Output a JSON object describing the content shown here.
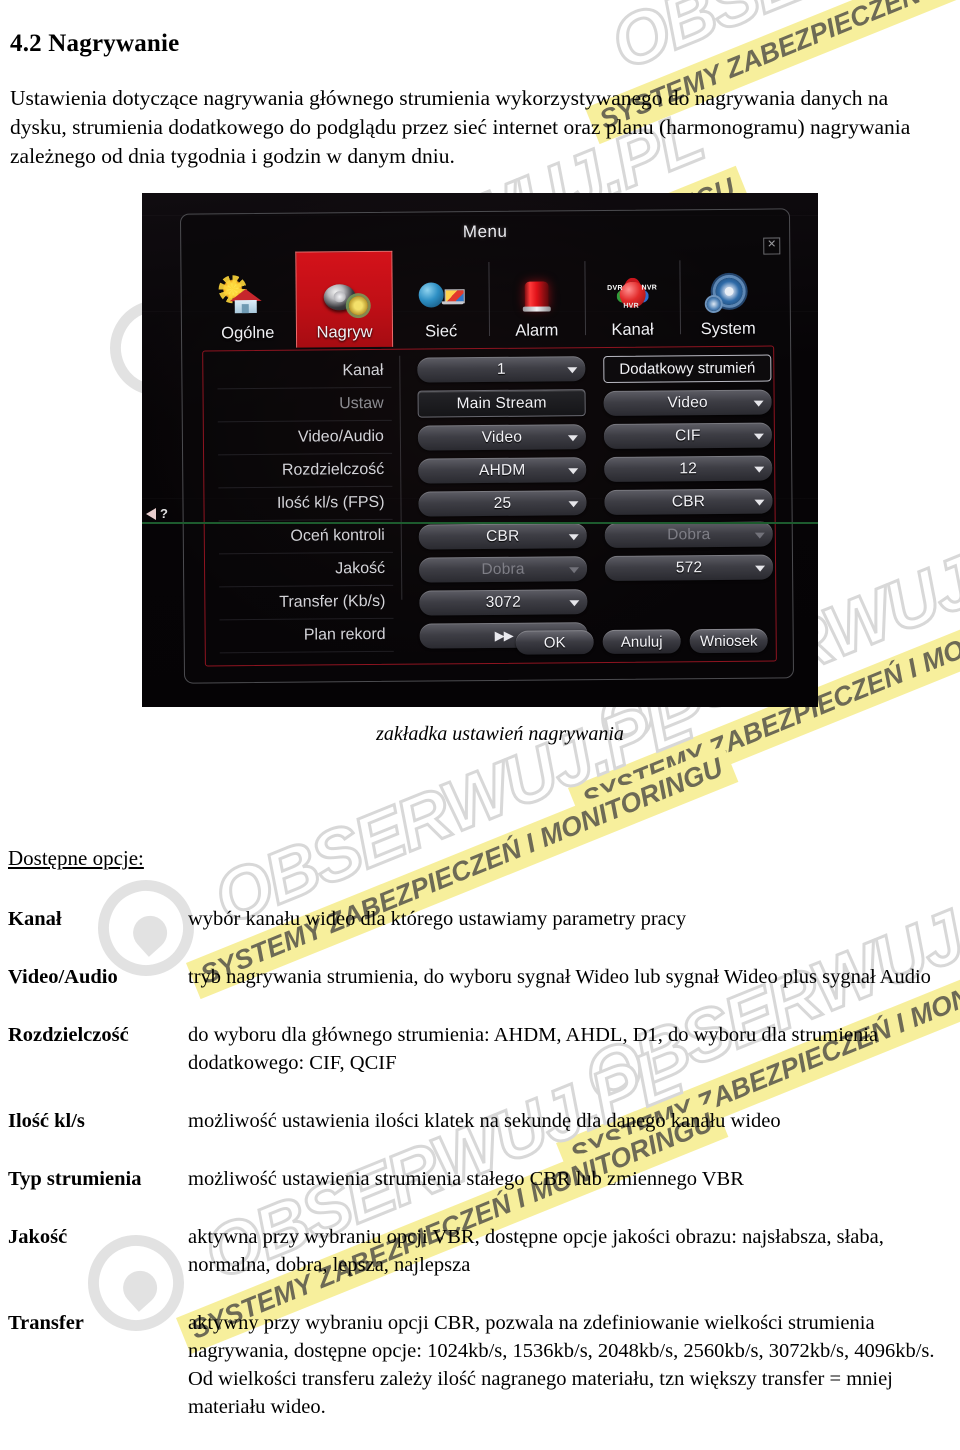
{
  "document": {
    "heading": "4.2 Nagrywanie",
    "intro": "Ustawienia dotyczące nagrywania głównego strumienia wykorzystywanego do nagrywania danych na dysku, strumienia dodatkowego do podglądu przez sieć internet oraz planu (harmonogramu) nagrywania zależnego od dnia tygodnia i godzin w danym dniu.",
    "figure_caption": "zakładka ustawień nagrywania"
  },
  "watermark": {
    "brand": "OBSERWUJ.PL",
    "tagline": "SYSTEMY ZABEZPIECZEŃ I MONITORINGU",
    "brand_color": "#d8d8d8",
    "bar_color": "#f7ef9c"
  },
  "dvr": {
    "window_title": "Menu",
    "close_icon": "✕",
    "tabs": [
      {
        "label": "Ogólne",
        "icon": "house-sun-icon",
        "active": false
      },
      {
        "label": "Nagryw",
        "icon": "film-reel-gear-icon",
        "active": true
      },
      {
        "label": "Sieć",
        "icon": "globe-laptop-icon",
        "active": false
      },
      {
        "label": "Alarm",
        "icon": "alarm-beacon-icon",
        "active": false
      },
      {
        "label": "Kanał",
        "icon": "dvr-nvr-hvr-icon",
        "active": false
      },
      {
        "label": "System",
        "icon": "blue-gear-icon",
        "active": false
      }
    ],
    "kanal_icon_labels": {
      "dvr": "DVR",
      "nvr": "NVR",
      "hvr": "HVR"
    },
    "field_labels": [
      {
        "text": "Kanał",
        "dim": false
      },
      {
        "text": "Ustaw",
        "dim": true
      },
      {
        "text": "Video/Audio",
        "dim": false
      },
      {
        "text": "Rozdzielczość",
        "dim": false
      },
      {
        "text": "Ilość kl/s (FPS)",
        "dim": false
      },
      {
        "text": "Oceń kontroli",
        "dim": false
      },
      {
        "text": "Jakość",
        "dim": false
      },
      {
        "text": "Transfer (Kb/s)",
        "dim": false
      },
      {
        "text": "Plan rekord",
        "dim": false
      }
    ],
    "main_column": [
      {
        "value": "1",
        "type": "dropdown",
        "dim": false
      },
      {
        "value": "Main Stream",
        "type": "flat",
        "dim": false
      },
      {
        "value": "Video",
        "type": "dropdown",
        "dim": false
      },
      {
        "value": "AHDM",
        "type": "dropdown",
        "dim": false
      },
      {
        "value": "25",
        "type": "dropdown",
        "dim": false
      },
      {
        "value": "CBR",
        "type": "dropdown",
        "dim": false
      },
      {
        "value": "Dobra",
        "type": "dropdown",
        "dim": true
      },
      {
        "value": "3072",
        "type": "dropdown",
        "dim": false
      },
      {
        "value": "▶▶",
        "type": "forward",
        "dim": false
      }
    ],
    "sub_column": {
      "header": "Dodatkowy strumień",
      "fields": [
        {
          "value": "Video",
          "dim": false
        },
        {
          "value": "CIF",
          "dim": false
        },
        {
          "value": "12",
          "dim": false
        },
        {
          "value": "CBR",
          "dim": false
        },
        {
          "value": "Dobra",
          "dim": true
        },
        {
          "value": "572",
          "dim": false
        }
      ]
    },
    "buttons": [
      {
        "label": "OK"
      },
      {
        "label": "Anuluj"
      },
      {
        "label": "Wniosek"
      }
    ]
  },
  "options": {
    "heading": "Dostępne opcje:",
    "rows": [
      {
        "term": "Kanał",
        "description": "wybór kanału wideo dla którego ustawiamy parametry pracy"
      },
      {
        "term": "Video/Audio",
        "description": "tryb nagrywania strumienia, do wyboru sygnał Wideo lub sygnał Wideo plus sygnał Audio"
      },
      {
        "term": "Rozdzielczość",
        "description": "do wyboru dla głównego strumienia: AHDM, AHDL, D1, do wyboru dla strumienia dodatkowego: CIF, QCIF"
      },
      {
        "term": "Ilość kl/s",
        "description": "możliwość ustawienia ilości klatek na sekundę dla danego kanału wideo"
      },
      {
        "term": "Typ strumienia",
        "description": "możliwość ustawienia strumienia stałego CBR lub zmiennego VBR"
      },
      {
        "term": "Jakość",
        "description": "aktywna przy wybraniu opcji VBR, dostępne opcje jakości obrazu: najsłabsza, słaba, normalna, dobra, lepsza, najlepsza"
      },
      {
        "term": "Transfer",
        "description": "aktywny przy wybraniu opcji CBR, pozwala na zdefiniowanie wielkości strumienia nagrywania, dostępne opcje: 1024kb/s, 1536kb/s, 2048kb/s, 2560kb/s, 3072kb/s, 4096kb/s. Od wielkości transferu zależy ilość nagranego materiału, tzn większy transfer = mniej materiału wideo."
      }
    ]
  }
}
